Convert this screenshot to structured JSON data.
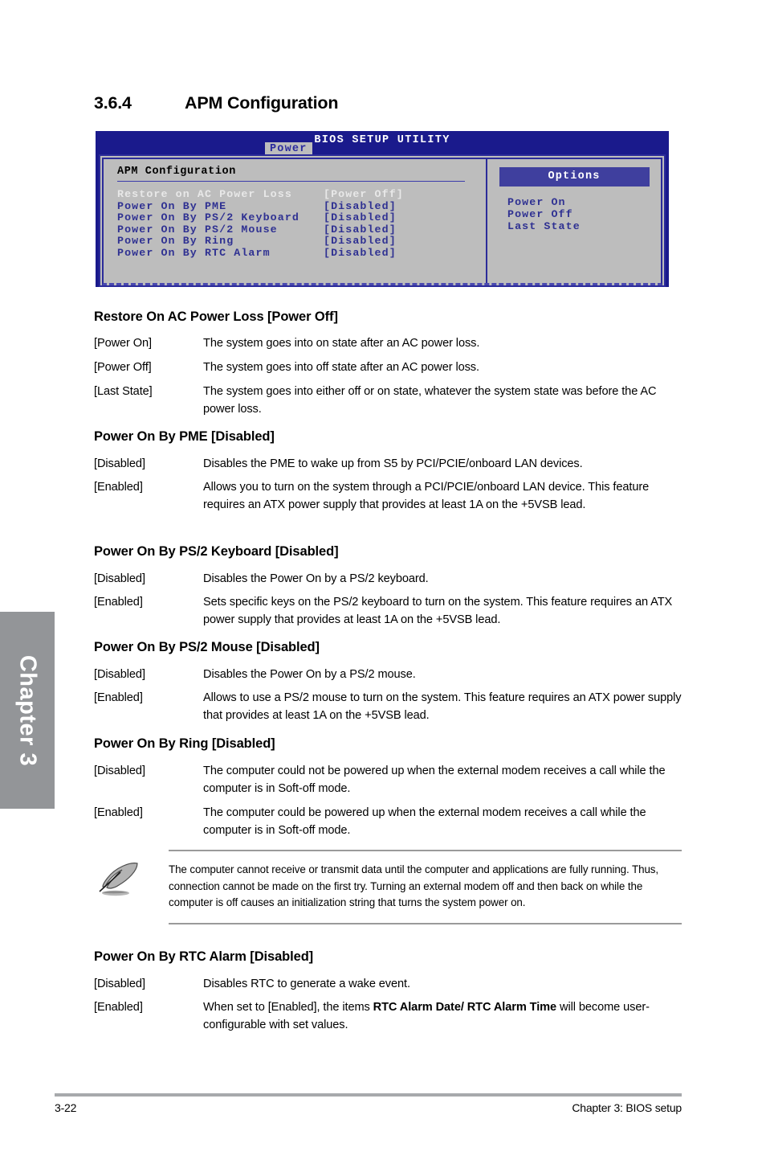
{
  "section": {
    "number": "3.6.4",
    "title": "APM Configuration"
  },
  "bios": {
    "title": "BIOS SETUP UTILITY",
    "active_tab": "Power",
    "panel_heading": "APM Configuration",
    "settings": [
      {
        "name": "Restore on AC Power Loss",
        "value": "[Power Off]",
        "selected": true
      },
      {
        "name": "Power On By PME",
        "value": "[Disabled]",
        "selected": false
      },
      {
        "name": "Power On By PS/2 Keyboard",
        "value": "[Disabled]",
        "selected": false
      },
      {
        "name": "Power On By PS/2 Mouse",
        "value": "[Disabled]",
        "selected": false
      },
      {
        "name": "Power On By Ring",
        "value": "[Disabled]",
        "selected": false
      },
      {
        "name": "Power On By RTC Alarm",
        "value": "[Disabled]",
        "selected": false
      }
    ],
    "options_header": "Options",
    "options": [
      "Power On",
      "Power Off",
      "Last State"
    ],
    "colors": {
      "screen_blue": "#1a1a8c",
      "panel_gray": "#bdbdbd",
      "text_blue": "#2f3192",
      "options_header_bg": "#3f3f9e",
      "selected_text": "#e8e8e8"
    }
  },
  "items": [
    {
      "heading": "Restore On AC Power Loss [Power Off]",
      "definitions": [
        {
          "term": "[Power On]",
          "desc": "The system goes into on state after an AC power loss."
        },
        {
          "term": "[Power Off]",
          "desc": "The system goes into off state after an AC power loss."
        },
        {
          "term": "[Last State]",
          "desc": "The system goes into either off or on state, whatever the system state was before the AC power loss."
        }
      ]
    },
    {
      "heading": "Power On By PME [Disabled]",
      "definitions": [
        {
          "term": "[Disabled]",
          "desc": "Disables the PME to wake up from S5 by PCI/PCIE/onboard LAN devices."
        },
        {
          "term": "[Enabled]",
          "desc": "Allows you to turn on the system through a PCI/PCIE/onboard LAN device. This feature requires an ATX power supply that provides at least 1A on the +5VSB lead."
        }
      ]
    },
    {
      "heading": "Power On By PS/2 Keyboard [Disabled]",
      "definitions": [
        {
          "term": "[Disabled]",
          "desc": "Disables the Power On by a PS/2 keyboard."
        },
        {
          "term": "[Enabled]",
          "desc": "Sets specific keys on the PS/2 keyboard to turn on the system. This feature requires an ATX power supply that provides at least 1A on the +5VSB lead."
        }
      ]
    },
    {
      "heading": "Power On By PS/2 Mouse [Disabled]",
      "definitions": [
        {
          "term": "[Disabled]",
          "desc": "Disables the Power On by a PS/2 mouse."
        },
        {
          "term": "[Enabled]",
          "desc": "Allows to use a PS/2 mouse to turn on the system. This feature requires an ATX power supply that provides at least 1A on the +5VSB lead."
        }
      ]
    },
    {
      "heading": "Power On By Ring [Disabled]",
      "definitions": [
        {
          "term": "[Disabled]",
          "desc": "The computer could not be powered up when the external modem receives a call while the computer is in Soft-off mode."
        },
        {
          "term": "[Enabled]",
          "desc": "The computer could be powered up when the external modem receives a call while the computer is in Soft-off mode."
        }
      ]
    },
    {
      "heading": "Power On By RTC Alarm [Disabled]",
      "definitions": [
        {
          "term": "[Disabled]",
          "desc": "Disables RTC to generate a wake event."
        },
        {
          "term": "[Enabled]",
          "desc": "When set to [Enabled], the items RTC Alarm Date/ RTC Alarm Time will become user-configurable with set values."
        }
      ]
    }
  ],
  "note": {
    "text": "The computer cannot receive or transmit data until the computer and applications are fully running. Thus, connection cannot be made on the first try. Turning an external modem off and then back on while the computer is off causes an initialization string that turns the system power on."
  },
  "chapter_tab": {
    "label": "Chapter 3"
  },
  "footer": {
    "page_number": "3-22",
    "chapter_text": "Chapter 3: BIOS setup"
  }
}
